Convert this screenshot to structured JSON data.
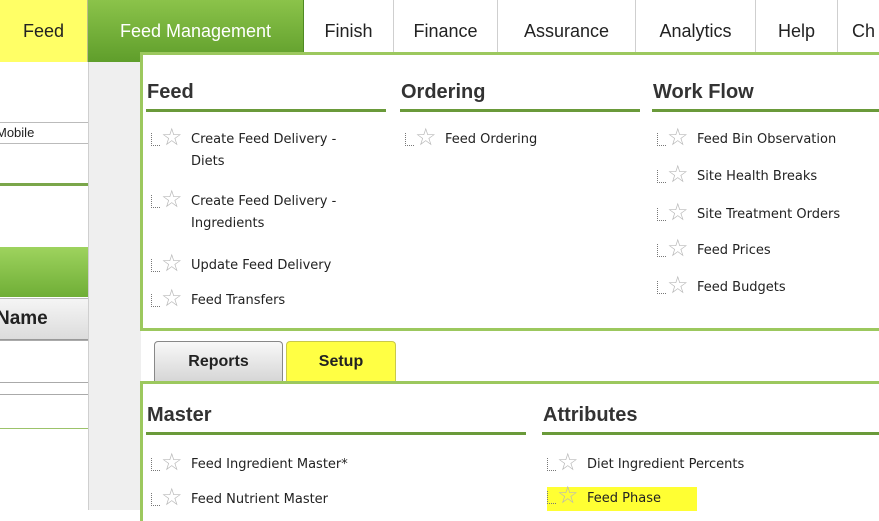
{
  "menu": {
    "items": [
      {
        "label": "Feed"
      },
      {
        "label": "Feed Management"
      },
      {
        "label": "Finish"
      },
      {
        "label": "Finance"
      },
      {
        "label": "Assurance"
      },
      {
        "label": "Analytics"
      },
      {
        "label": "Help"
      },
      {
        "label": "Ch"
      }
    ]
  },
  "left_panel": {
    "mobile_label": "Mobile",
    "name_header": "Name"
  },
  "top_panel": {
    "feed": {
      "title": "Feed",
      "items": [
        {
          "label_line1": "Create Feed Delivery -",
          "label_line2": "Diets"
        },
        {
          "label_line1": "Create Feed Delivery -",
          "label_line2": "Ingredients"
        },
        {
          "label_line1": "Update Feed Delivery"
        },
        {
          "label_line1": "Feed Transfers"
        }
      ]
    },
    "ordering": {
      "title": "Ordering",
      "items": [
        {
          "label": "Feed Ordering"
        }
      ]
    },
    "workflow": {
      "title": "Work Flow",
      "items": [
        {
          "label": "Feed Bin Observation"
        },
        {
          "label": "Site Health Breaks"
        },
        {
          "label": "Site Treatment Orders"
        },
        {
          "label": "Feed Prices"
        },
        {
          "label": "Feed Budgets"
        }
      ]
    }
  },
  "tabs": [
    {
      "label": "Reports"
    },
    {
      "label": "Setup"
    }
  ],
  "bottom_panel": {
    "master": {
      "title": "Master",
      "items": [
        {
          "label": "Feed Ingredient Master*"
        },
        {
          "label": "Feed Nutrient Master"
        }
      ]
    },
    "attributes": {
      "title": "Attributes",
      "items": [
        {
          "label": "Diet Ingredient Percents"
        },
        {
          "label": "Feed Phase"
        }
      ]
    }
  },
  "colors": {
    "accent_green": "#6a9a3a",
    "highlight_yellow": "#ffff44"
  }
}
